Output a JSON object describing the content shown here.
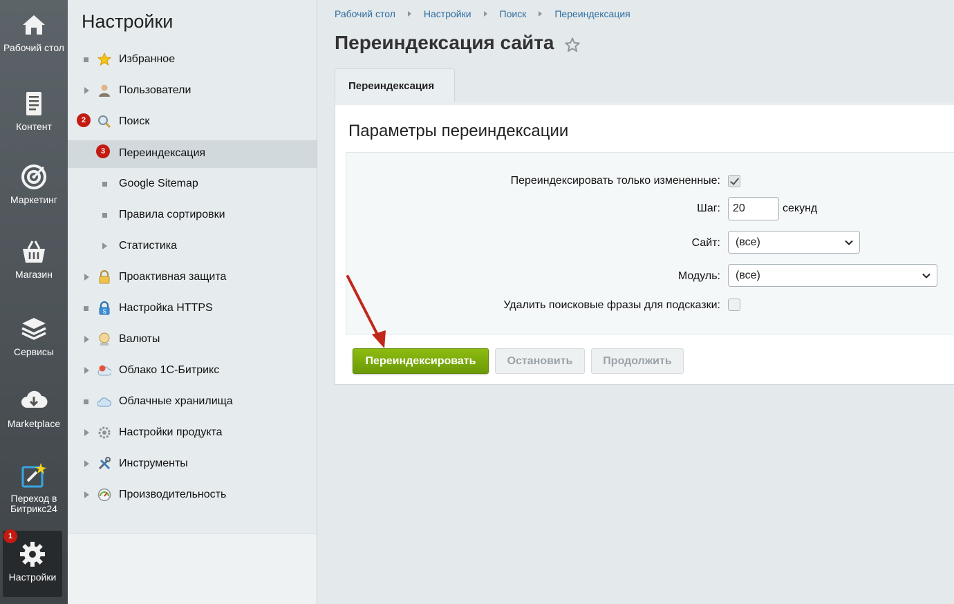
{
  "rail": {
    "items": [
      {
        "label": "Рабочий стол",
        "icon": "home-icon"
      },
      {
        "label": "Контент",
        "icon": "document-icon"
      },
      {
        "label": "Маркетинг",
        "icon": "target-icon"
      },
      {
        "label": "Магазин",
        "icon": "basket-icon"
      },
      {
        "label": "Сервисы",
        "icon": "layers-icon"
      },
      {
        "label": "Marketplace",
        "icon": "cloud-download-icon"
      },
      {
        "label": "Переход в Битрикс24",
        "icon": "bitrix24-icon"
      },
      {
        "label": "Настройки",
        "icon": "gear-icon",
        "active": true,
        "badge": "1"
      }
    ]
  },
  "menu": {
    "title": "Настройки",
    "items": [
      {
        "label": "Избранное",
        "icon": "star-icon",
        "marker": "dot"
      },
      {
        "label": "Пользователи",
        "icon": "user-icon",
        "marker": "arrow"
      },
      {
        "label": "Поиск",
        "icon": "magnifier-icon",
        "badge": "2"
      },
      {
        "label": "Переиндексация",
        "badge": "3",
        "selected": true
      },
      {
        "label": "Google Sitemap",
        "marker": "dot"
      },
      {
        "label": "Правила сортировки",
        "marker": "dot"
      },
      {
        "label": "Статистика",
        "marker": "arrow"
      },
      {
        "label": "Проактивная защита",
        "icon": "lock-icon",
        "marker": "arrow"
      },
      {
        "label": "Настройка HTTPS",
        "icon": "https-lock-icon",
        "marker": "dot"
      },
      {
        "label": "Валюты",
        "icon": "currency-icon",
        "marker": "arrow"
      },
      {
        "label": "Облако 1С-Битрикс",
        "icon": "cloud-icon",
        "marker": "arrow"
      },
      {
        "label": "Облачные хранилища",
        "icon": "cloud-storage-icon",
        "marker": "dot"
      },
      {
        "label": "Настройки продукта",
        "icon": "settings-icon",
        "marker": "arrow"
      },
      {
        "label": "Инструменты",
        "icon": "tools-icon",
        "marker": "arrow"
      },
      {
        "label": "Производительность",
        "icon": "speedometer-icon",
        "marker": "arrow"
      }
    ]
  },
  "breadcrumb": [
    "Рабочий стол",
    "Настройки",
    "Поиск",
    "Переиндексация"
  ],
  "page_title": "Переиндексация сайта",
  "tab_label": "Переиндексация",
  "section_title": "Параметры переиндексации",
  "form": {
    "only_changed": {
      "label": "Переиндексировать только измененные:",
      "checked": true
    },
    "step": {
      "label": "Шаг:",
      "value": "20",
      "unit": "секунд"
    },
    "site": {
      "label": "Сайт:",
      "value": "(все)"
    },
    "module": {
      "label": "Модуль:",
      "value": "(все)"
    },
    "delete_phrases": {
      "label": "Удалить поисковые фразы для подсказки:",
      "checked": false
    }
  },
  "buttons": {
    "reindex": "Переиндексировать",
    "stop": "Остановить",
    "continue": "Продолжить"
  },
  "colors": {
    "accent_green": "#7aa80c",
    "badge_red": "#c31b11",
    "link_blue": "#2e6ea0",
    "annotation_arrow": "#c0281a"
  }
}
